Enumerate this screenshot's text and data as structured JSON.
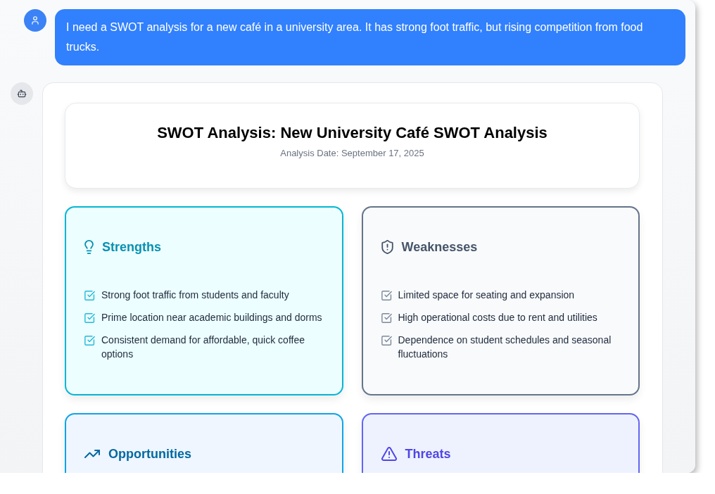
{
  "user_message": {
    "text": "I need a SWOT analysis for a new café in a university area. It has strong foot traffic, but rising competition from food trucks."
  },
  "report": {
    "title": "SWOT Analysis: New University Café SWOT Analysis",
    "date": "Analysis Date: September 17, 2025",
    "quadrants": [
      {
        "kind": "strengths",
        "title": "Strengths",
        "items": [
          "Strong foot traffic from students and faculty",
          "Prime location near academic buildings and dorms",
          "Consistent demand for affordable, quick coffee options"
        ]
      },
      {
        "kind": "weaknesses",
        "title": "Weaknesses",
        "items": [
          "Limited space for seating and expansion",
          "High operational costs due to rent and utilities",
          "Dependence on student schedules and seasonal fluctuations"
        ]
      },
      {
        "kind": "opportunities",
        "title": "Opportunities"
      },
      {
        "kind": "threats",
        "title": "Threats"
      }
    ]
  }
}
